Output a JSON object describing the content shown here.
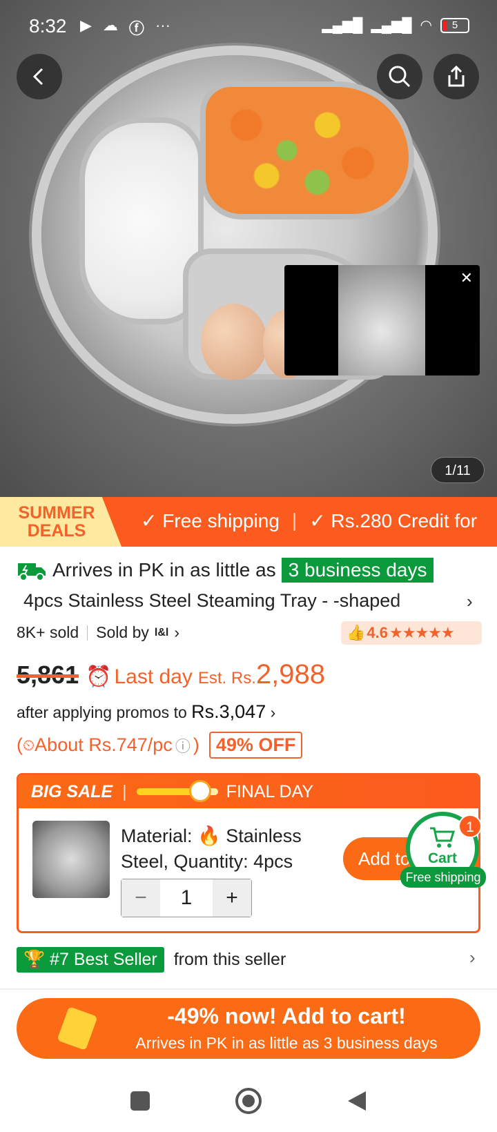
{
  "status_bar": {
    "time": "8:32",
    "battery": "5"
  },
  "gallery": {
    "counter": "1/11"
  },
  "promo_strip": {
    "badge_line1": "SUMMER",
    "badge_line2": "DEALS",
    "items": [
      "✓ Free shipping",
      "✓ Rs.280 Credit for"
    ]
  },
  "delivery": {
    "prefix": "Arrives in PK in as little as",
    "highlight": "3 business days"
  },
  "product": {
    "title": "4pcs Stainless Steel Steaming Tray - -shaped",
    "sold": "8K+ sold",
    "sold_by": "Sold by",
    "seller_logo": "l&l",
    "rating": "4.6"
  },
  "price": {
    "original": "5,861",
    "last_day": "Last day",
    "est": "Est. Rs.",
    "current": "2,988",
    "after_promos": "after applying promos to",
    "promo_price": "Rs.3,047",
    "per_pc_open": "(",
    "per_pc": "About Rs.747/pc",
    "per_pc_close": ")",
    "discount": "49% OFF"
  },
  "big_sale": {
    "title": "BIG SALE",
    "final": "FINAL DAY",
    "progress": 0.74,
    "material_label": "Material:",
    "material_value": "Stainless Steel, Quantity: 4pcs",
    "quantity": "1",
    "add_button": "Add to"
  },
  "cart": {
    "label": "Cart",
    "count": "1",
    "free_shipping": "Free shipping"
  },
  "best_seller": {
    "badge": "#7 Best Seller",
    "text": "from this seller"
  },
  "cta": {
    "line1": "-49% now! Add to cart!",
    "line2": "Arrives in PK in as little as 3 business days"
  },
  "colors": {
    "accent": "#fb5b1e",
    "green": "#0a9a3b"
  }
}
